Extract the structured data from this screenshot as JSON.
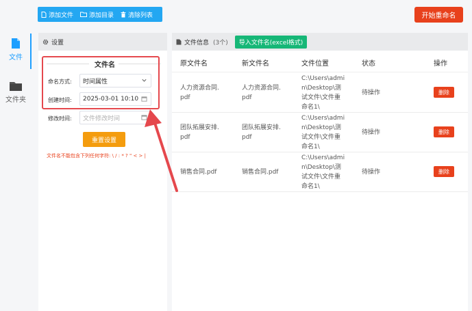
{
  "rail": {
    "items": [
      {
        "label": "文件",
        "icon": "file-icon"
      },
      {
        "label": "文件夹",
        "icon": "folder-icon"
      }
    ]
  },
  "toolbar": {
    "add_file": "添加文件",
    "add_dir": "添加目录",
    "clear_list": "清除列表"
  },
  "start_button": "开始重命名",
  "settings": {
    "title": "设置",
    "group_title": "文件名",
    "naming_label": "命名方式:",
    "naming_value": "时间属性",
    "created_label": "创建时间:",
    "created_value": "2025-03-01 10:10",
    "modified_label": "修改时间:",
    "modified_placeholder": "文件修改时间",
    "reset_button": "重置设置",
    "warning": "文件名不能包含下列任何字符: \\ / : * ? \" < > |"
  },
  "files": {
    "title": "文件信息",
    "count": "(3个)",
    "import_button": "导入文件名(excel格式)",
    "columns": [
      "原文件名",
      "新文件名",
      "文件位置",
      "状态",
      "操作"
    ],
    "rows": [
      {
        "orig": [
          "人力资源合同.",
          "pdf"
        ],
        "new": [
          "人力资源合同.",
          "pdf"
        ],
        "loc": [
          "C:\\Users\\admi",
          "n\\Desktop\\测",
          "试文件\\文件重",
          "命名1\\"
        ],
        "status": "待操作",
        "action": "删除"
      },
      {
        "orig": [
          "团队拓展安排.",
          "pdf"
        ],
        "new": [
          "团队拓展安排.",
          "pdf"
        ],
        "loc": [
          "C:\\Users\\admi",
          "n\\Desktop\\测",
          "试文件\\文件重",
          "命名1\\"
        ],
        "status": "待操作",
        "action": "删除"
      },
      {
        "orig": [
          "销售合同.pdf"
        ],
        "new": [
          "销售合同.pdf"
        ],
        "loc": [
          "C:\\Users\\admi",
          "n\\Desktop\\测",
          "试文件\\文件重",
          "命名1\\"
        ],
        "status": "待操作",
        "action": "删除"
      }
    ]
  },
  "colors": {
    "accent": "#1e9fff",
    "toolbar": "#23a7f2",
    "danger": "#e8411c",
    "reset": "#f49c0e",
    "import": "#16b777",
    "highlight": "#e5484d"
  }
}
